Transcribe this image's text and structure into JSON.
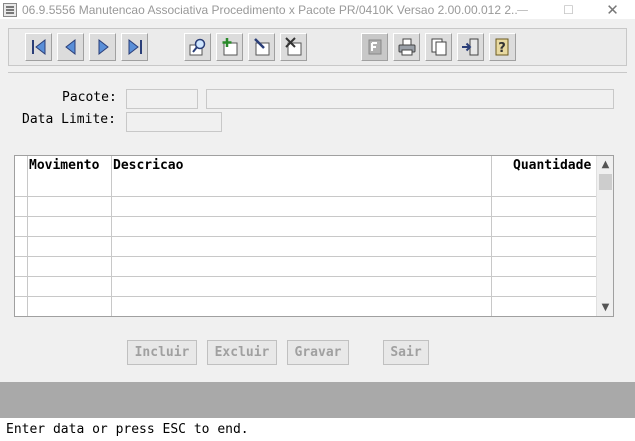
{
  "window": {
    "title": "06.9.5556 Manutencao Associativa Procedimento x Pacote PR/0410K Versao 2.00.00.012 2...",
    "minimize_glyph": "—",
    "maximize_glyph": "☐",
    "close_glyph": "✕"
  },
  "toolbar": {
    "buttons": [
      {
        "name": "first-record-button",
        "icon": "first-icon"
      },
      {
        "name": "previous-record-button",
        "icon": "previous-icon"
      },
      {
        "name": "next-record-button",
        "icon": "next-icon"
      },
      {
        "name": "last-record-button",
        "icon": "last-icon"
      },
      {
        "name": "search-button",
        "icon": "magnifier-icon"
      },
      {
        "name": "add-button",
        "icon": "add-icon"
      },
      {
        "name": "edit-button",
        "icon": "edit-icon"
      },
      {
        "name": "delete-button",
        "icon": "delete-icon"
      },
      {
        "name": "fields-button",
        "icon": "fields-icon"
      },
      {
        "name": "print-button",
        "icon": "printer-icon"
      },
      {
        "name": "copy-button",
        "icon": "copy-icon"
      },
      {
        "name": "exit-button",
        "icon": "exit-door-icon"
      },
      {
        "name": "help-button",
        "icon": "help-icon"
      }
    ]
  },
  "form": {
    "pacote_label": "Pacote:",
    "pacote_code": "",
    "pacote_description": "",
    "data_limite_label": "Data Limite:",
    "data_limite_value": ""
  },
  "grid": {
    "columns": [
      "Movimento",
      "Descricao",
      "Quantidade"
    ],
    "rows": [
      [
        "",
        "",
        ""
      ],
      [
        "",
        "",
        ""
      ],
      [
        "",
        "",
        ""
      ],
      [
        "",
        "",
        ""
      ],
      [
        "",
        "",
        ""
      ],
      [
        "",
        "",
        ""
      ]
    ],
    "scroll_up": "▲",
    "scroll_down": "▼"
  },
  "actions": {
    "incluir": "Incluir",
    "excluir": "Excluir",
    "gravar": "Gravar",
    "sair": "Sair"
  },
  "status": {
    "message": "Enter data or press ESC to end."
  }
}
